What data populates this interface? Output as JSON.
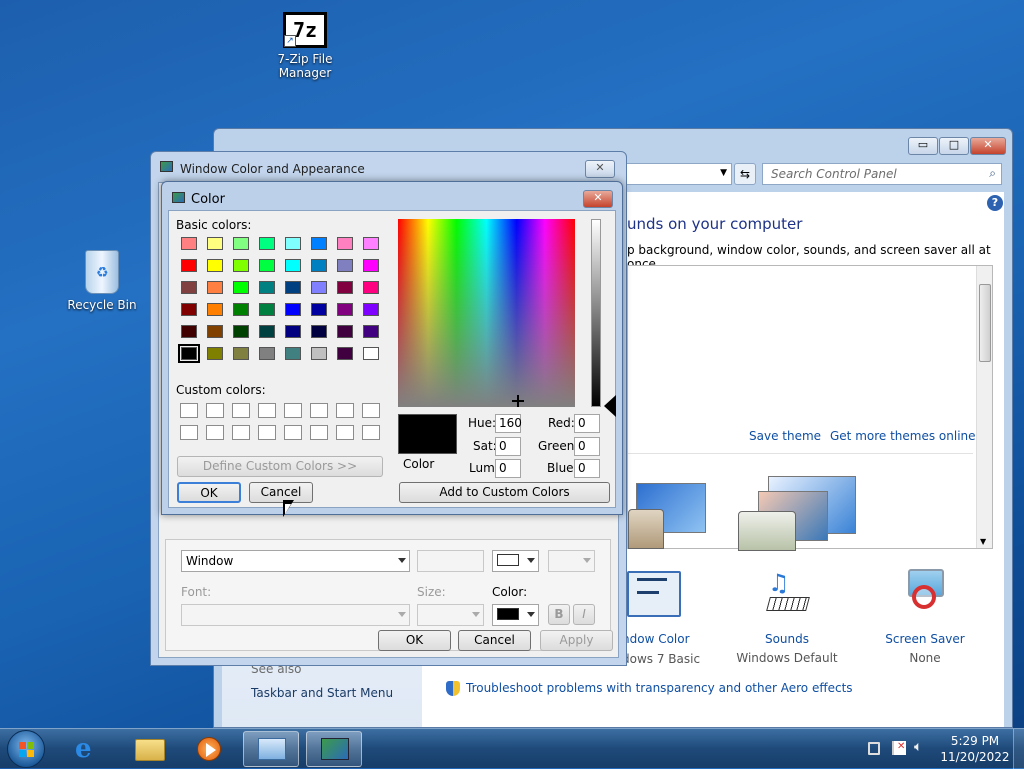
{
  "desktop": {
    "icons": [
      {
        "label": "7-Zip File Manager",
        "glyph": "7z"
      },
      {
        "label": "Recycle Bin"
      }
    ]
  },
  "control_panel": {
    "search_placeholder": "Search Control Panel",
    "heading": "unds on your computer",
    "description": "p background, window color, sounds, and screen saver all at once.",
    "save_theme": "Save theme",
    "get_more_themes": "Get more themes online",
    "window_color_label": "ndow Color",
    "window_color_value": "dows 7 Basic",
    "sounds_label": "Sounds",
    "sounds_value": "Windows Default",
    "screensaver_label": "Screen Saver",
    "screensaver_value": "None",
    "see_also": "See also",
    "taskbar_link": "Taskbar and Start Menu",
    "troubleshoot_link": "Troubleshoot problems with transparency and other Aero effects"
  },
  "window_color_dialog": {
    "title": "Window Color and Appearance",
    "item_value": "Window",
    "font_label": "Font:",
    "size_label": "Size:",
    "color_label": "Color:",
    "bold_label": "B",
    "italic_label": "I",
    "ok": "OK",
    "cancel": "Cancel",
    "apply": "Apply"
  },
  "color_dialog": {
    "title": "Color",
    "basic_colors_label": "Basic colors:",
    "custom_colors_label": "Custom colors:",
    "define_custom": "Define Custom Colors >>",
    "ok": "OK",
    "cancel": "Cancel",
    "add_to_custom": "Add to Custom Colors",
    "color_solid_label": "Color",
    "hue_label": "Hue:",
    "hue": "160",
    "sat_label": "Sat:",
    "sat": "0",
    "lum_label": "Lum:",
    "lum": "0",
    "red_label": "Red:",
    "red": "0",
    "green_label": "Green:",
    "green": "0",
    "blue_label": "Blue:",
    "blue": "0",
    "basic_colors": [
      "#ff8080",
      "#ffff80",
      "#80ff80",
      "#00ff80",
      "#80ffff",
      "#0080ff",
      "#ff80c0",
      "#ff80ff",
      "#ff0000",
      "#ffff00",
      "#80ff00",
      "#00ff40",
      "#00ffff",
      "#0080c0",
      "#8080c0",
      "#ff00ff",
      "#804040",
      "#ff8040",
      "#00ff00",
      "#008080",
      "#004080",
      "#8080ff",
      "#800040",
      "#ff0080",
      "#800000",
      "#ff8000",
      "#008000",
      "#008040",
      "#0000ff",
      "#0000a0",
      "#800080",
      "#8000ff",
      "#400000",
      "#804000",
      "#004000",
      "#004040",
      "#000080",
      "#000040",
      "#400040",
      "#400080",
      "#000000",
      "#808000",
      "#808040",
      "#808080",
      "#408080",
      "#c0c0c0",
      "#400040",
      "#ffffff"
    ],
    "selected_color": "#000000"
  },
  "taskbar": {
    "time": "5:29 PM",
    "date": "11/20/2022"
  }
}
